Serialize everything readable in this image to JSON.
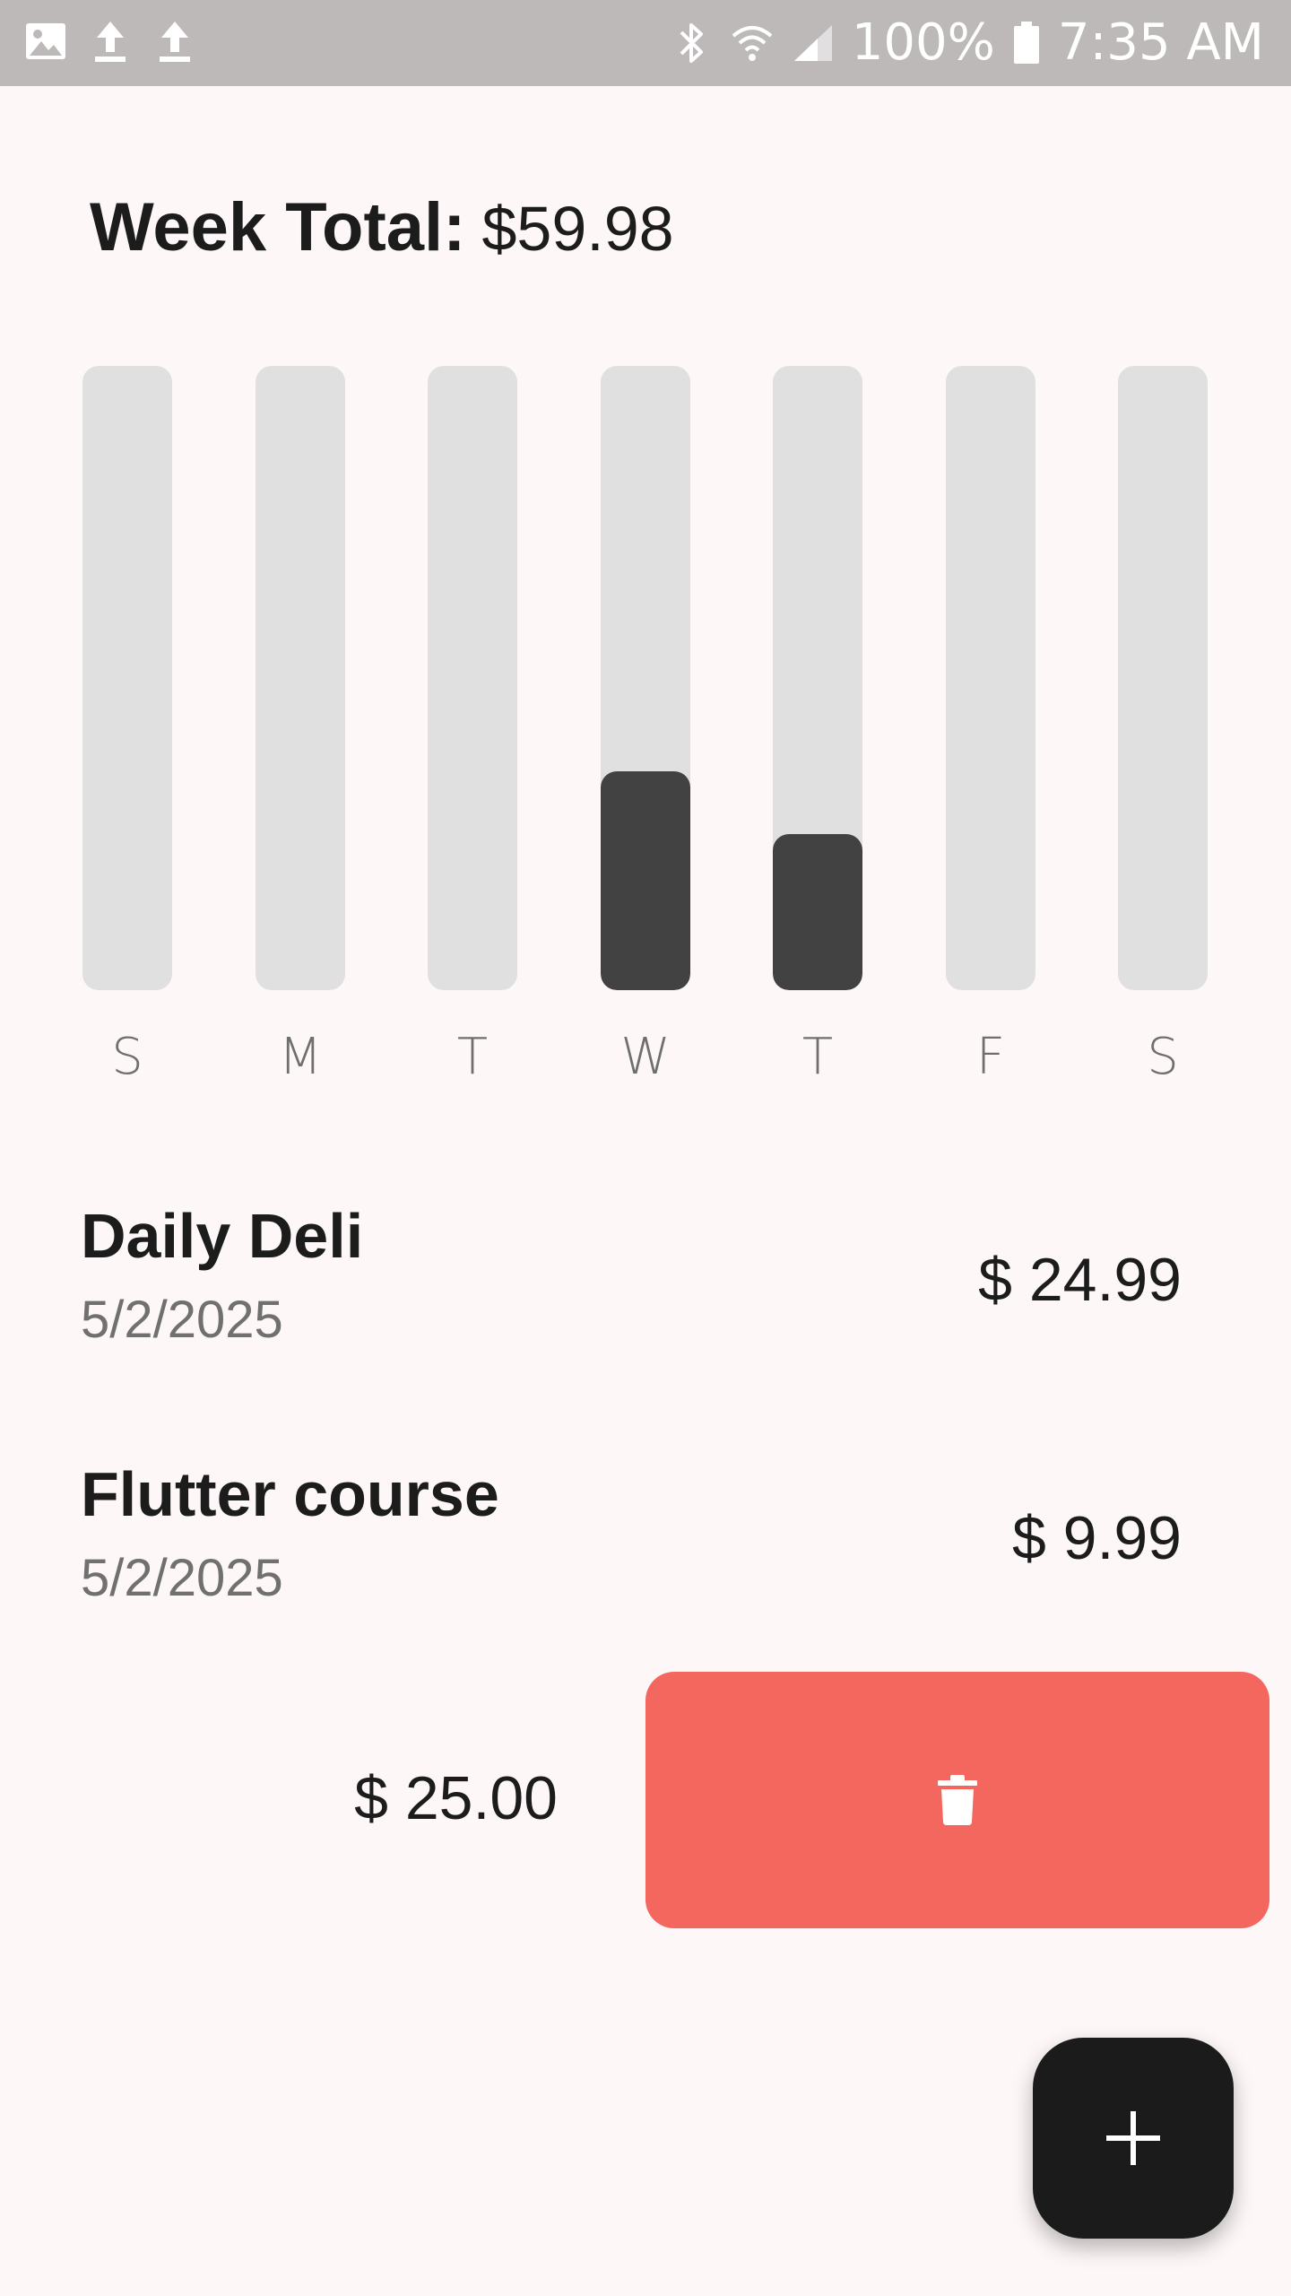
{
  "status_bar": {
    "battery_percent": "100%",
    "time": "7:35 AM",
    "icons": [
      "image-icon",
      "upload-icon",
      "upload-icon",
      "bluetooth-icon",
      "wifi-icon",
      "signal-icon",
      "battery-icon"
    ]
  },
  "summary": {
    "label": "Week Total:",
    "value": "$59.98"
  },
  "chart_data": {
    "type": "bar",
    "categories": [
      "S",
      "M",
      "T",
      "W",
      "T",
      "F",
      "S"
    ],
    "values": [
      0,
      0,
      0,
      24.99,
      9.99,
      0,
      0
    ],
    "fill_fraction": [
      0,
      0,
      0,
      0.35,
      0.25,
      0,
      0
    ],
    "colors": {
      "track": "#e0e0e0",
      "fill": "#424242"
    }
  },
  "transactions": [
    {
      "title": "Daily Deli",
      "date": "5/2/2025",
      "amount": "$ 24.99"
    },
    {
      "title": "Flutter course",
      "date": "5/2/2025",
      "amount": "$ 9.99"
    }
  ],
  "swiped_item": {
    "amount": "$ 25.00",
    "action_icon": "trash-icon",
    "action_color": "#f4675f"
  },
  "fab": {
    "icon": "plus-icon"
  },
  "colors": {
    "background": "#fdf7f7",
    "status_bar": "#bcb9b8",
    "text": "#1c1c1c",
    "muted_text": "#707070",
    "fab": "#1b1b1b"
  }
}
